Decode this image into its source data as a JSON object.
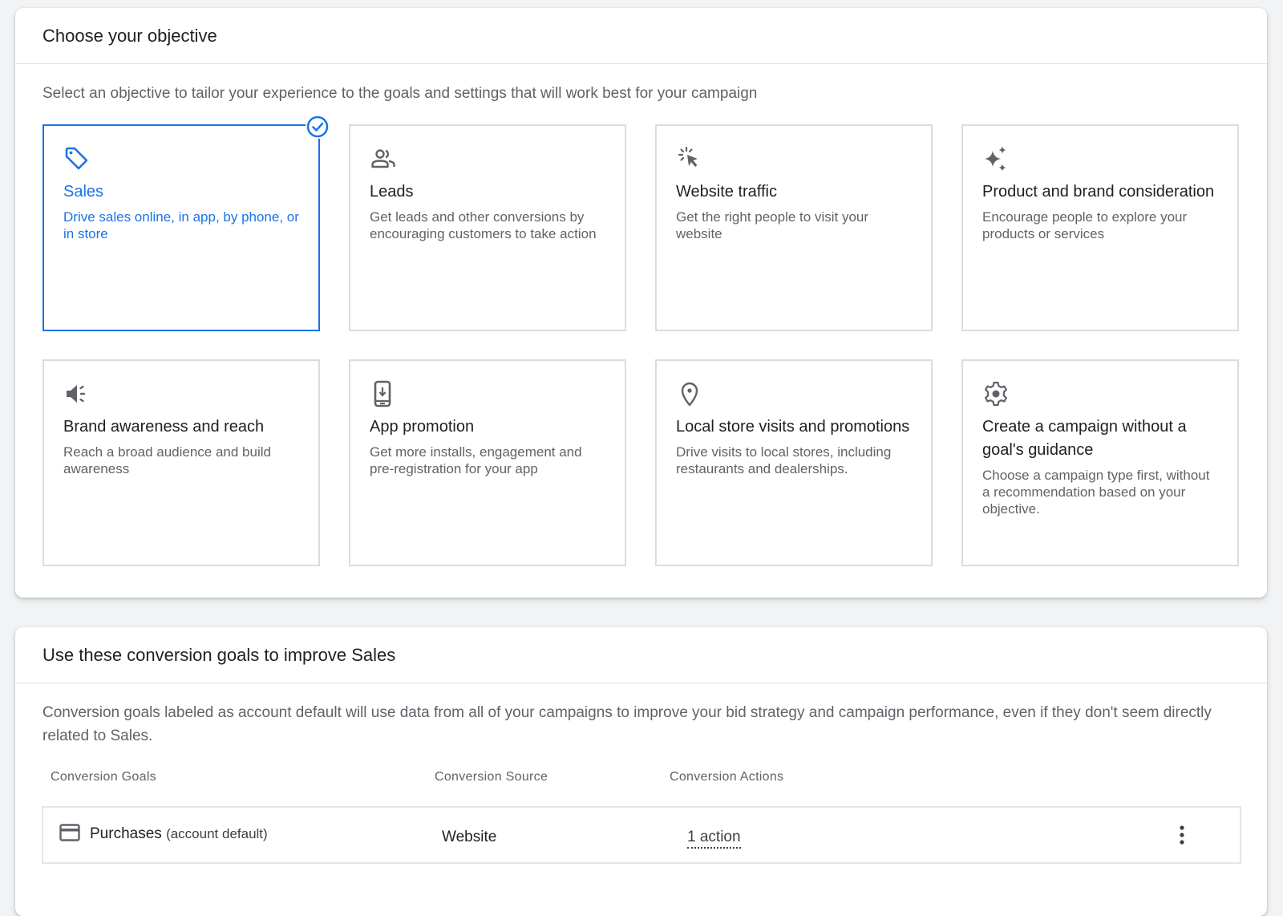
{
  "objective_panel": {
    "title": "Choose your objective",
    "description": "Select an objective to tailor your experience to the goals and settings that will work best for your campaign",
    "selected": "Sales",
    "accent_color": "#1a73e8",
    "cards": [
      {
        "icon": "tag-icon",
        "title": "Sales",
        "description": "Drive sales online, in app, by phone, or in store",
        "selected": true
      },
      {
        "icon": "people-icon",
        "title": "Leads",
        "description": "Get leads and other conversions by encouraging customers to take action",
        "selected": false
      },
      {
        "icon": "cursor-click-icon",
        "title": "Website traffic",
        "description": "Get the right people to visit your website",
        "selected": false
      },
      {
        "icon": "sparkle-icon",
        "title": "Product and brand consideration",
        "description": "Encourage people to explore your products or services",
        "selected": false
      },
      {
        "icon": "megaphone-icon",
        "title": "Brand awareness and reach",
        "description": "Reach a broad audience and build awareness",
        "selected": false
      },
      {
        "icon": "phone-download-icon",
        "title": "App promotion",
        "description": "Get more installs, engagement and pre-registration for your app",
        "selected": false
      },
      {
        "icon": "location-pin-icon",
        "title": "Local store visits and promotions",
        "description": "Drive visits to local stores, including restaurants and dealerships.",
        "selected": false
      },
      {
        "icon": "gear-icon",
        "title": "Create a campaign without a goal's guidance",
        "description": "Choose a campaign type first, without a recommendation based on your objective.",
        "selected": false
      }
    ]
  },
  "goals_panel": {
    "title": "Use these conversion goals to improve Sales",
    "description": "Conversion goals labeled as account default will use data from all of your campaigns to improve your bid strategy and campaign performance, even if they don't seem directly related to Sales.",
    "columns": [
      "Conversion Goals",
      "Conversion Source",
      "Conversion Actions"
    ],
    "rows": [
      {
        "icon": "credit-card-icon",
        "goal": "Purchases",
        "goal_suffix": "(account default)",
        "source": "Website",
        "actions": "1 action"
      }
    ]
  }
}
